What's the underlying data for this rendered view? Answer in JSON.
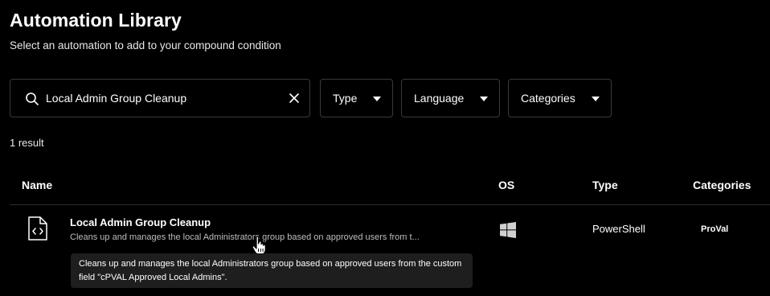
{
  "header": {
    "title": "Automation Library",
    "subtitle": "Select an automation to add to your compound condition"
  },
  "search": {
    "value": "Local Admin Group Cleanup",
    "icon": "search-icon",
    "clear_icon": "close-icon"
  },
  "filters": [
    {
      "label": "Type",
      "icon": "chevron-down-icon"
    },
    {
      "label": "Language",
      "icon": "chevron-down-icon"
    },
    {
      "label": "Categories",
      "icon": "chevron-down-icon"
    }
  ],
  "results": {
    "count_text": "1 result"
  },
  "table": {
    "columns": [
      "Name",
      "OS",
      "Type",
      "Categories"
    ],
    "rows": [
      {
        "icon": "script-file-icon",
        "name": "Local Admin Group Cleanup",
        "description": "Cleans up and manages the local Administrators group based on approved users from t...",
        "os_icon": "windows-icon",
        "type": "PowerShell",
        "category": "ProVal"
      }
    ]
  },
  "tooltip": {
    "text": "Cleans up and manages the local Administrators group based on approved users from the custom field \"cPVAL Approved Local Admins\"."
  },
  "colors": {
    "background": "#000000",
    "border": "#3a3a3a",
    "tooltip_bg": "#1e1e1e",
    "muted_text": "#bdbdbd"
  }
}
